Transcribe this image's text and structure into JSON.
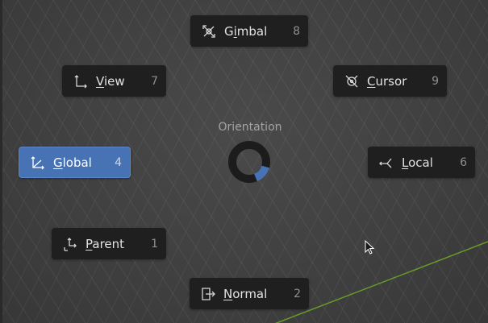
{
  "pie_menu": {
    "title": "Orientation",
    "items": [
      {
        "name": "Gimbal",
        "mnemonic": "i",
        "prefix": "G",
        "rest": "mbal",
        "key": "8",
        "icon": "gimbal-icon"
      },
      {
        "name": "View",
        "mnemonic": "V",
        "prefix": "",
        "rest": "iew",
        "key": "7",
        "icon": "view-orientation-icon"
      },
      {
        "name": "Cursor",
        "mnemonic": "C",
        "prefix": "",
        "rest": "ursor",
        "key": "9",
        "icon": "cursor-orientation-icon"
      },
      {
        "name": "Global",
        "mnemonic": "G",
        "prefix": "",
        "rest": "lobal",
        "key": "4",
        "icon": "global-orientation-icon",
        "active": true
      },
      {
        "name": "Local",
        "mnemonic": "L",
        "prefix": "",
        "rest": "ocal",
        "key": "6",
        "icon": "local-orientation-icon"
      },
      {
        "name": "Parent",
        "mnemonic": "P",
        "prefix": "",
        "rest": "arent",
        "key": "1",
        "icon": "parent-orientation-icon"
      },
      {
        "name": "Normal",
        "mnemonic": "N",
        "prefix": "",
        "rest": "ormal",
        "key": "2",
        "icon": "normal-orientation-icon"
      }
    ]
  },
  "colors": {
    "active": "#4772b3",
    "item_bg": "#1f1f1f",
    "ring": "#1c1c1c",
    "ring_indicator": "#4772b3",
    "axis_green": "#6a9a2a"
  }
}
